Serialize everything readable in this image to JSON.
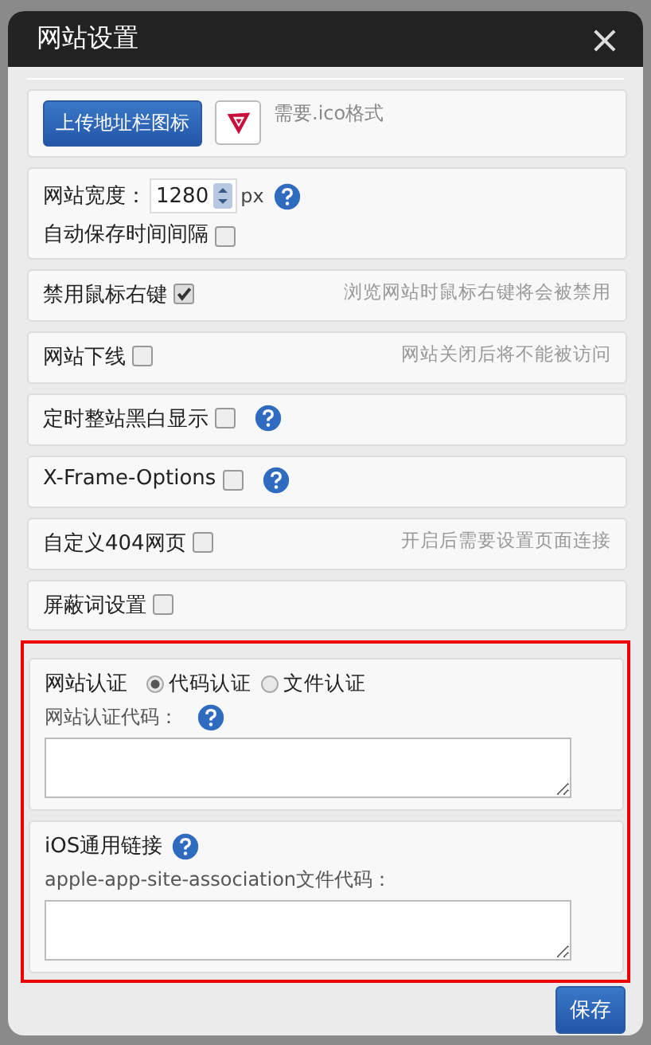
{
  "dialog": {
    "title": "网站设置",
    "close": "×"
  },
  "favicon": {
    "button": "上传地址栏图标",
    "hint": "需要.ico格式"
  },
  "width": {
    "label": "网站宽度：",
    "value": "1280",
    "unit": "px"
  },
  "autosave": {
    "label": "自动保存时间间隔",
    "checked": false
  },
  "toggles": [
    {
      "label": "禁用鼠标右键",
      "checked": true,
      "hint": "浏览网站时鼠标右键将会被禁用",
      "help": false
    },
    {
      "label": "网站下线",
      "checked": false,
      "hint": "网站关闭后将不能被访问",
      "help": false
    },
    {
      "label": "定时整站黑白显示",
      "checked": false,
      "help": true
    },
    {
      "label": "X-Frame-Options",
      "checked": false,
      "help": true
    },
    {
      "label": "自定义404网页",
      "checked": false,
      "hint": "开启后需要设置页面连接",
      "help": false
    },
    {
      "label": "屏蔽词设置",
      "checked": false,
      "help": false
    }
  ],
  "verification": {
    "title": "网站认证",
    "options": [
      {
        "label": "代码认证",
        "selected": true
      },
      {
        "label": "文件认证",
        "selected": false
      }
    ],
    "code_label": "网站认证代码："
  },
  "ios": {
    "title": "iOS通用链接",
    "code_label": "apple-app-site-association文件代码："
  },
  "save": "保存"
}
